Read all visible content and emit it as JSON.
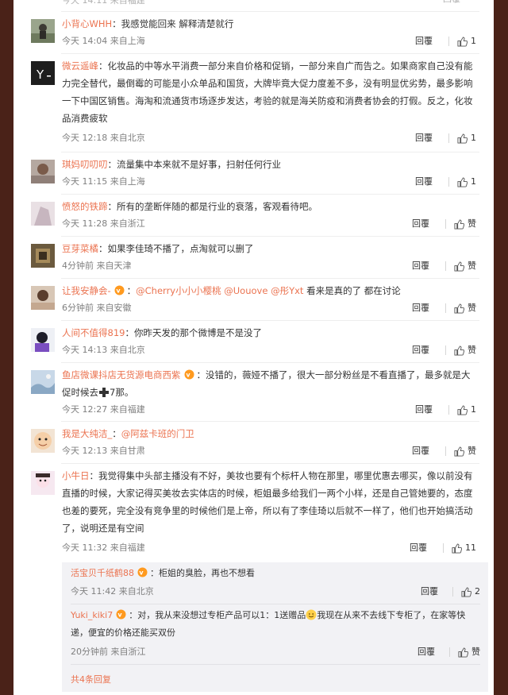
{
  "clipped_top": {
    "meta": "今天 14:11 来自福建",
    "reply": "回覆"
  },
  "comments": [
    {
      "user": "小背心WHH",
      "text": "我感觉能回来 解释清楚就行",
      "time": "今天 14:04 来自上海",
      "reply": "回覆",
      "likes": "1"
    },
    {
      "user": "微云遥峰",
      "text": "化妆品的中等水平消费一部分来自价格和促销，一部分来自广而告之。如果商家自己没有能力完全替代，最倒霉的可能是小众单品和国货，大牌毕竟大促力度差不多，没有明显优劣势，最多影响一下中国区销售。海淘和流通货市场逐步发达，考验的就是海关防疫和消费者协会的打假。反之，化妆品消费疲软",
      "time": "今天 12:18 来自北京",
      "reply": "回覆",
      "likes": "1"
    },
    {
      "user": "琪妈叨叨叨",
      "text": "流量集中本来就不是好事，扫射任何行业",
      "time": "今天 11:15 来自上海",
      "reply": "回覆",
      "likes": "1"
    },
    {
      "user": "愤怒的铁蹄",
      "text": "所有的垄断伴随的都是行业的衰落，客观看待吧。",
      "time": "今天 11:28 来自浙江",
      "reply": "回覆",
      "likes": "赞"
    },
    {
      "user": "豆芽菜橘",
      "text": "如果李佳琦不播了，点淘就可以删了",
      "time": "4分钟前 来自天津",
      "reply": "回覆",
      "likes": "赞"
    },
    {
      "user": "让我安静会-",
      "mentions": "@Cherry小小小樱桃 @Uouove @彤Yxt",
      "text": "看来是真的了 都在讨论",
      "time": "6分钟前 来自安徽",
      "reply": "回覆",
      "likes": "赞"
    },
    {
      "user": "人间不值得819",
      "text": "你昨天发的那个微博是不是没了",
      "time": "今天 14:13 来自北京",
      "reply": "回覆",
      "likes": "赞"
    },
    {
      "user": "鱼店微课抖店无货源电商西紫",
      "text_a": "没错的，薇娅不播了，很大一部分粉丝是不看直播了，最多就是大促时候去",
      "text_b": "7那。",
      "time": "今天 12:27 来自福建",
      "reply": "回覆",
      "likes": "1"
    },
    {
      "user": "我是大纯洁_",
      "mention": "@阿兹卡班的门卫",
      "time": "今天 12:13 来自甘肃",
      "reply": "回覆",
      "likes": "赞"
    },
    {
      "user": "小牛日",
      "text": "我觉得集中头部主播没有不好，美妆也要有个标杆人物在那里，哪里优惠去哪买，像以前没有直播的时候，大家记得买美妆去实体店的时候，柜姐最多给我们一两个小样，还是自己管她要的，态度也差的要死，完全没有竞争里的时候他们是上帝，所以有了李佳琦以后就不一样了，他们也开始搞活动了，说明还是有空间",
      "time": "今天 11:32 来自福建",
      "reply": "回覆",
      "likes": "11"
    }
  ],
  "subreplies": [
    {
      "user": "活宝贝千纸鹤88",
      "text": "柜姐的臭脸，再也不想看",
      "time": "今天 11:42 来自北京",
      "reply": "回覆",
      "likes": "2"
    },
    {
      "user": "Yuki_kiki7",
      "text_a": "对，我从来没想过专柜产品可以1：1送赠品",
      "text_b": "我现在从来不去线下专柜了，在家等快递，便宜的价格还能买双份",
      "time": "20分钟前 来自浙江",
      "reply": "回覆",
      "likes": "赞"
    }
  ],
  "more_replies": "共4条回复",
  "colors": {
    "username": "#eb7350",
    "text": "#333333",
    "meta": "#808080",
    "subbox": "#f2f2f5",
    "frame": "#4a2218"
  }
}
